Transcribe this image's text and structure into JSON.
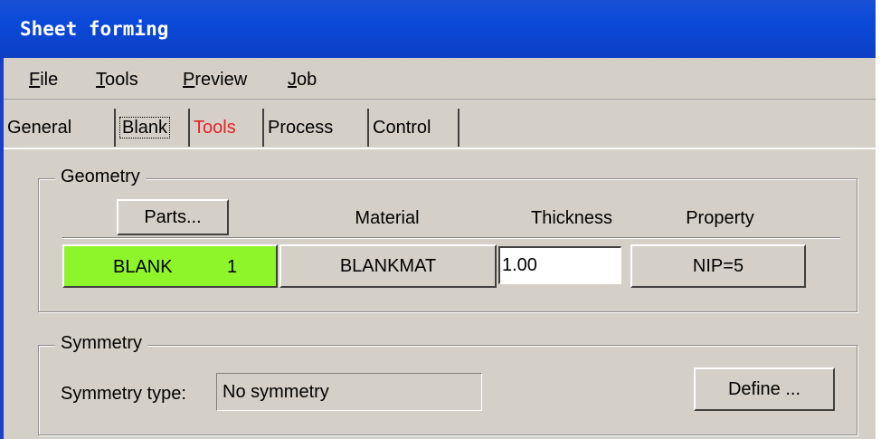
{
  "window": {
    "title": "Sheet forming"
  },
  "menu": [
    {
      "label": "File",
      "mnemonic": "F",
      "rest": "ile"
    },
    {
      "label": "Tools",
      "mnemonic": "T",
      "rest": "ools"
    },
    {
      "label": "Preview",
      "mnemonic": "P",
      "rest": "review"
    },
    {
      "label": "Job",
      "mnemonic": "J",
      "rest": "ob"
    }
  ],
  "tabs": [
    {
      "label": "General"
    },
    {
      "label": "Blank",
      "active": true
    },
    {
      "label": "Tools",
      "color": "#e8202a"
    },
    {
      "label": "Process"
    },
    {
      "label": "Control"
    }
  ],
  "geometry": {
    "group_label": "Geometry",
    "parts_button": "Parts...",
    "headers": {
      "material": "Material",
      "thickness": "Thickness",
      "property": "Property"
    },
    "row": {
      "part_name": "BLANK",
      "part_id": "1",
      "part_color": "#8ef52a",
      "material": "BLANKMAT",
      "thickness": "1.00",
      "property": "NIP=5"
    }
  },
  "symmetry": {
    "group_label": "Symmetry",
    "type_label": "Symmetry type:",
    "type_value": "No symmetry",
    "define_button": "Define ..."
  }
}
